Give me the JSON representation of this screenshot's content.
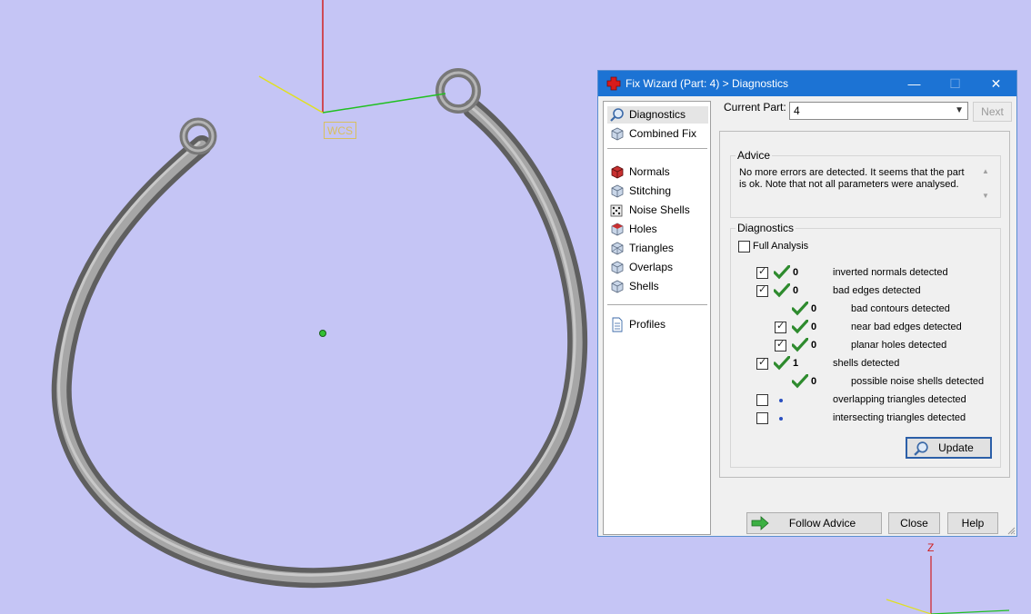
{
  "viewport": {
    "wcs_label": "WCS",
    "axis_z_label": "Z"
  },
  "dialog": {
    "title": "Fix Wizard (Part: 4) > Diagnostics",
    "minimize": "—",
    "maximize": "☐",
    "close": "✕",
    "nav": [
      {
        "label": "Diagnostics",
        "icon": "magnifier-icon",
        "selected": true
      },
      {
        "label": "Combined Fix",
        "icon": "cube-stack-icon"
      },
      {
        "label": "Normals",
        "icon": "cube-red-icon"
      },
      {
        "label": "Stitching",
        "icon": "cube-stitch-icon"
      },
      {
        "label": "Noise Shells",
        "icon": "dice-icon"
      },
      {
        "label": "Holes",
        "icon": "cube-holes-icon"
      },
      {
        "label": "Triangles",
        "icon": "cube-triangles-icon"
      },
      {
        "label": "Overlaps",
        "icon": "cube-overlap-icon"
      },
      {
        "label": "Shells",
        "icon": "cube-shells-icon"
      },
      {
        "label": "Profiles",
        "icon": "document-icon"
      }
    ],
    "current_part_label": "Current Part:",
    "current_part_value": "4",
    "next_label": "Next",
    "advice_title": "Advice",
    "advice_text": "No more errors are detected. It seems that the part is ok. Note that not all parameters were analysed.",
    "diagnostics_title": "Diagnostics",
    "full_analysis_label": "Full Analysis",
    "diagnostics": [
      {
        "checkbox": true,
        "checked": true,
        "status": "ok",
        "count": "0",
        "text": "inverted normals detected",
        "indent": 0
      },
      {
        "checkbox": true,
        "checked": true,
        "status": "ok",
        "count": "0",
        "text": "bad edges detected",
        "indent": 0
      },
      {
        "checkbox": false,
        "checked": false,
        "status": "ok",
        "count": "0",
        "text": "bad contours detected",
        "indent": 1
      },
      {
        "checkbox": true,
        "checked": true,
        "status": "ok",
        "count": "0",
        "text": "near bad edges detected",
        "indent": 1
      },
      {
        "checkbox": true,
        "checked": true,
        "status": "ok",
        "count": "0",
        "text": "planar holes detected",
        "indent": 1
      },
      {
        "checkbox": true,
        "checked": true,
        "status": "ok",
        "count": "1",
        "text": "shells detected",
        "indent": 0
      },
      {
        "checkbox": false,
        "checked": false,
        "status": "ok",
        "count": "0",
        "text": "possible noise shells detected",
        "indent": 1
      },
      {
        "checkbox": true,
        "checked": false,
        "status": "pending",
        "count": "",
        "text": "overlapping triangles detected",
        "indent": 0
      },
      {
        "checkbox": true,
        "checked": false,
        "status": "pending",
        "count": "",
        "text": "intersecting triangles detected",
        "indent": 0
      }
    ],
    "update_label": "Update",
    "follow_advice_label": "Follow Advice",
    "close_label": "Close",
    "help_label": "Help"
  },
  "colors": {
    "background": "#c5c5f5",
    "titlebar": "#1c73d4",
    "check_green": "#2e8b2e",
    "axis_red": "#d02020",
    "axis_green": "#20c020",
    "axis_yellow": "#e0e020"
  }
}
